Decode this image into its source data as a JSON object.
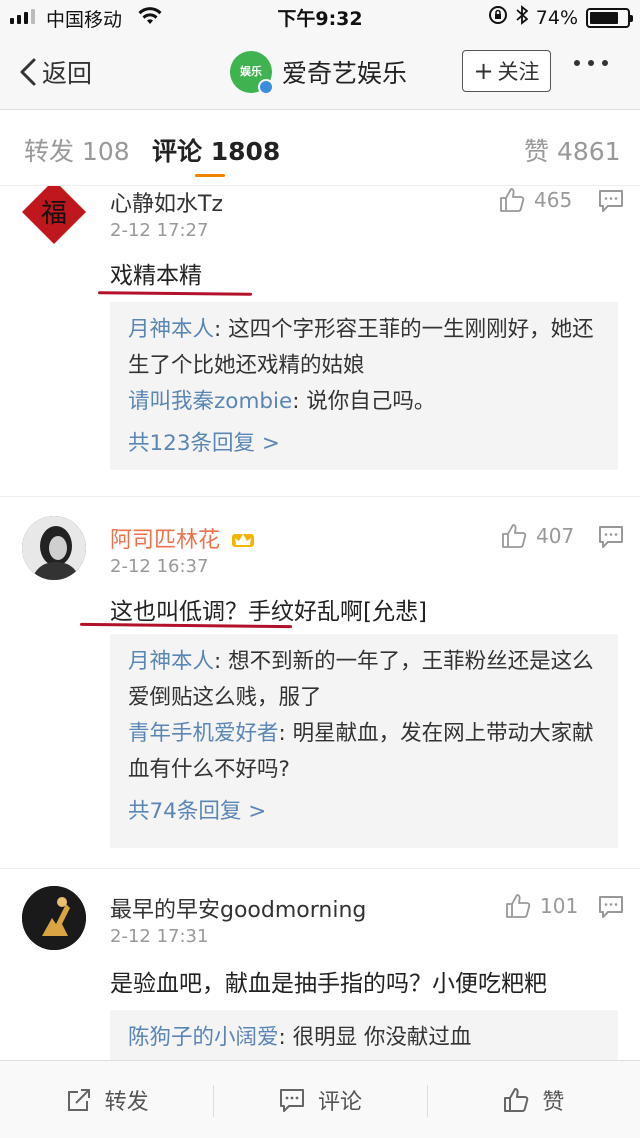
{
  "status_bar": {
    "carrier": "中国移动",
    "time": "下午9:32",
    "battery": "74%"
  },
  "nav": {
    "back_label": "返回",
    "account_name": "爱奇艺娱乐",
    "logo_text": "娱乐",
    "follow_label": "关注"
  },
  "tabs": [
    {
      "label": "转发",
      "count": "108"
    },
    {
      "label": "评论",
      "count": "1808"
    },
    {
      "label": "赞",
      "count": "4861"
    }
  ],
  "comments": [
    {
      "username": "心静如水Tz",
      "time": "2-12 17:27",
      "text": "戏精本精",
      "likes": "465",
      "replies": [
        {
          "name": "月神本人",
          "text": ": 这四个字形容王菲的一生刚刚好，她还生了个比她还戏精的姑娘"
        },
        {
          "name": "请叫我秦zombie",
          "text": ": 说你自己吗。"
        }
      ],
      "more_replies": "共123条回复 >"
    },
    {
      "username": "阿司匹林花",
      "time": "2-12 16:37",
      "text": "这也叫低调？手纹好乱啊[允悲]",
      "likes": "407",
      "replies": [
        {
          "name": "月神本人",
          "text": ": 想不到新的一年了，王菲粉丝还是这么爱倒贴这么贱，服了"
        },
        {
          "name": "青年手机爱好者",
          "text": ": 明星献血，发在网上带动大家献血有什么不好吗?"
        }
      ],
      "more_replies": "共74条回复 >"
    },
    {
      "username": "最早的早安goodmorning",
      "time": "2-12 17:31",
      "text": "是验血吧，献血是抽手指的吗？小便吃粑粑",
      "likes": "101",
      "replies": [
        {
          "name": "陈狗子的小阔爱",
          "text": ": 很明显 你没献过血"
        }
      ]
    }
  ],
  "toolbar": {
    "repost": "转发",
    "comment": "评论",
    "like": "赞"
  },
  "colors": {
    "accent_orange": "#f08300",
    "link_blue": "#5a86b5",
    "vip_orange": "#eb7350",
    "underline_red": "#b3112a",
    "brand_green": "#3fb34f"
  }
}
